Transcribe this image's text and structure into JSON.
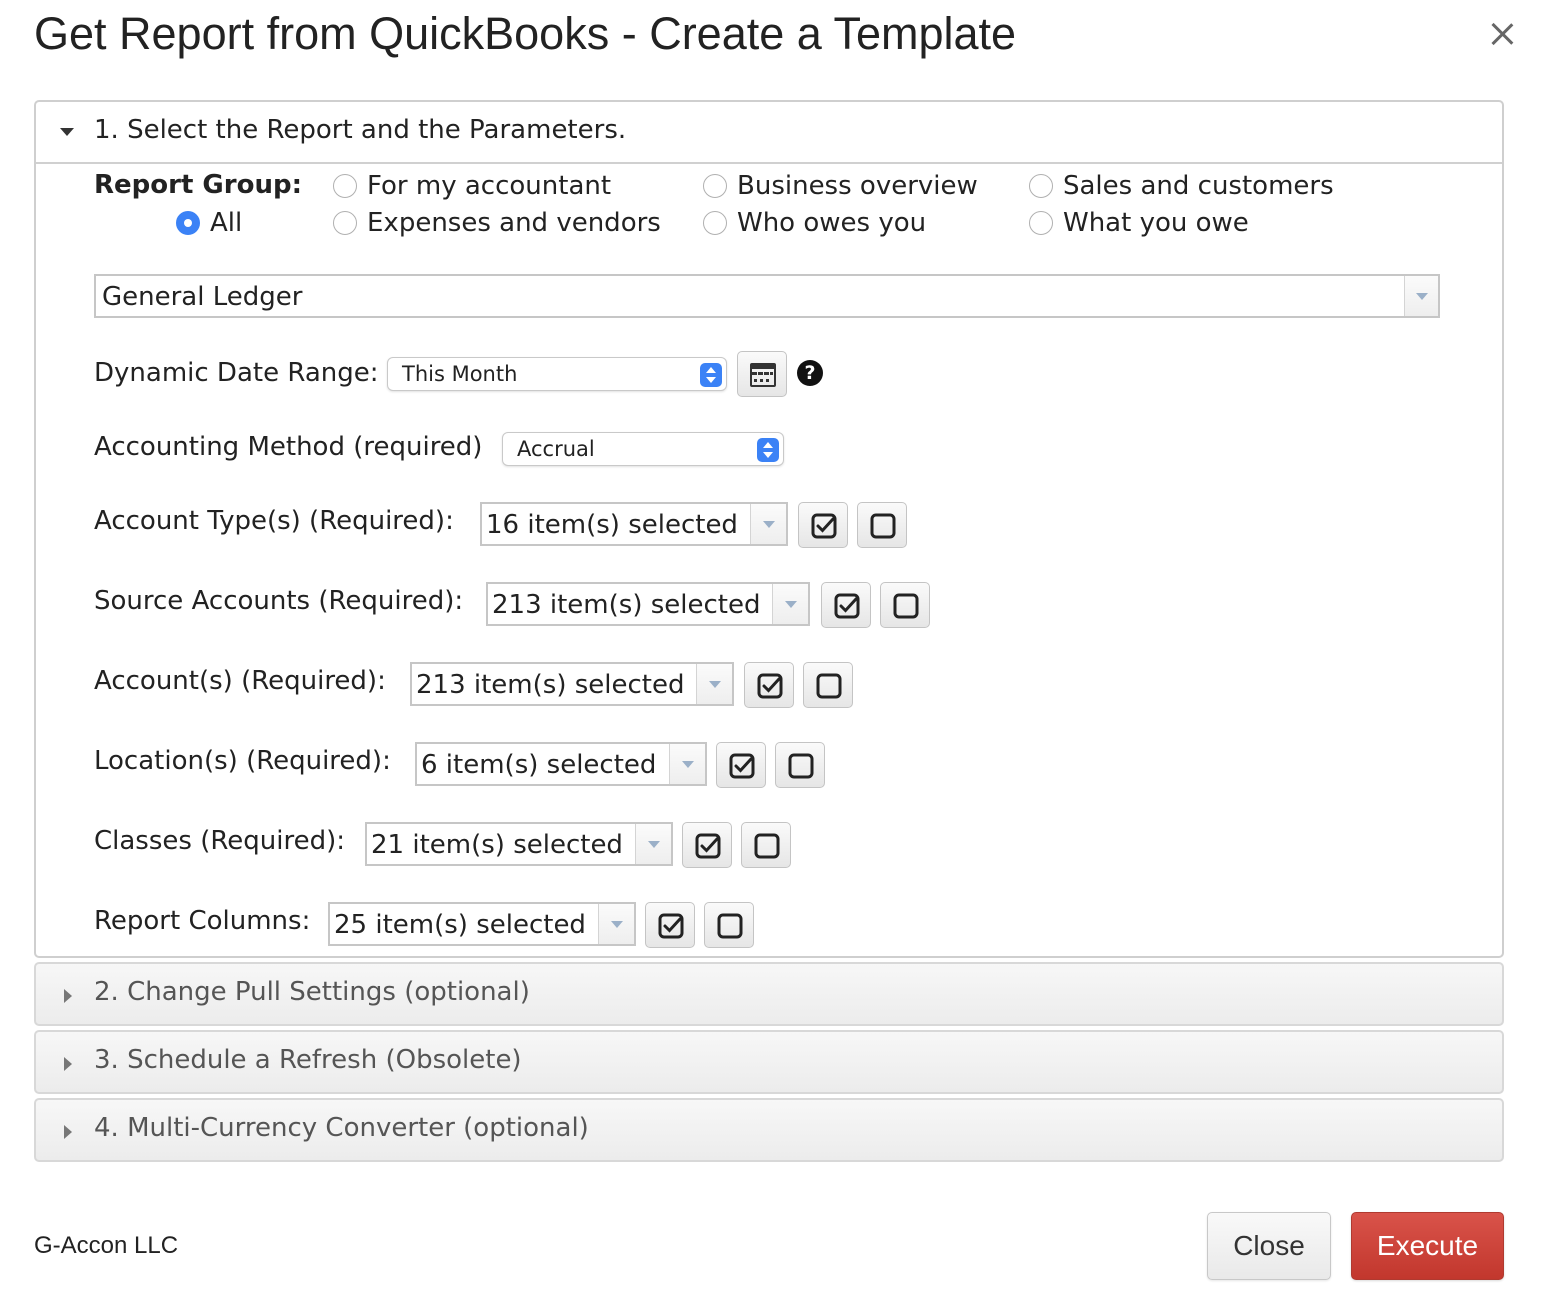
{
  "dialog": {
    "title": "Get Report from QuickBooks - Create a Template"
  },
  "section1": {
    "header": "1. Select the Report and the Parameters.",
    "report_group": {
      "label": "Report Group:",
      "options": [
        {
          "label": "All",
          "checked": true
        },
        {
          "label": "For my accountant",
          "checked": false
        },
        {
          "label": "Expenses and vendors",
          "checked": false
        },
        {
          "label": "Business overview",
          "checked": false
        },
        {
          "label": "Who owes you",
          "checked": false
        },
        {
          "label": "Sales and customers",
          "checked": false
        },
        {
          "label": "What you owe",
          "checked": false
        }
      ]
    },
    "report": {
      "value": "General Ledger"
    },
    "date_range": {
      "label": "Dynamic Date Range:",
      "value": "This Month",
      "help": "?"
    },
    "accounting_method": {
      "label": "Accounting Method (required)",
      "value": "Accrual"
    },
    "params": [
      {
        "label": "Account Type(s) (Required):",
        "value": "16 item(s) selected"
      },
      {
        "label": "Source Accounts (Required):",
        "value": "213 item(s) selected"
      },
      {
        "label": "Account(s) (Required):",
        "value": "213 item(s) selected"
      },
      {
        "label": "Location(s) (Required):",
        "value": "6 item(s) selected"
      },
      {
        "label": "Classes (Required):",
        "value": "21 item(s) selected"
      },
      {
        "label": "Report Columns:",
        "value": "25 item(s) selected"
      }
    ]
  },
  "section2": {
    "header": "2. Change Pull Settings (optional)"
  },
  "section3": {
    "header": "3. Schedule a Refresh (Obsolete)"
  },
  "section4": {
    "header": "4. Multi-Currency Converter (optional)"
  },
  "footer": {
    "company": "G-Accon LLC",
    "close_label": "Close",
    "execute_label": "Execute"
  },
  "colors": {
    "accent_blue": "#3b82f6",
    "execute_red": "#c9413a"
  }
}
